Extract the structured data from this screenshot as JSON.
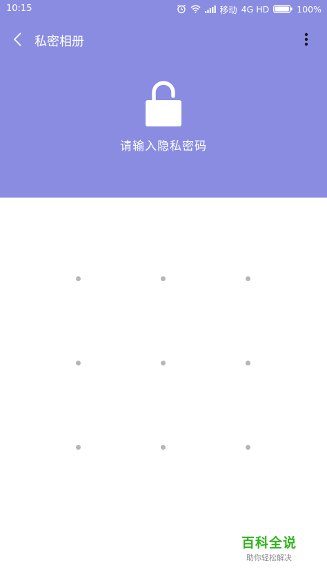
{
  "status_bar": {
    "time": "10:15",
    "carrier": "移动",
    "network": "4G HD",
    "battery": "100%",
    "icons": [
      "alarm-icon",
      "wifi-icon",
      "signal-icon",
      "battery-icon"
    ]
  },
  "app_bar": {
    "title": "私密相册",
    "back_icon": "chevron-left-icon",
    "menu_icon": "more-vertical-icon"
  },
  "lock": {
    "icon": "unlocked-padlock-icon",
    "prompt": "请输入隐私密码"
  },
  "pattern_lock": {
    "rows": 3,
    "cols": 3
  },
  "watermark": {
    "main": "百科全说",
    "sub": "助你轻松解决"
  },
  "colors": {
    "header_bg": "#8a8ce2",
    "dot": "#b6b6b6",
    "watermark_main": "#2fb31f"
  }
}
